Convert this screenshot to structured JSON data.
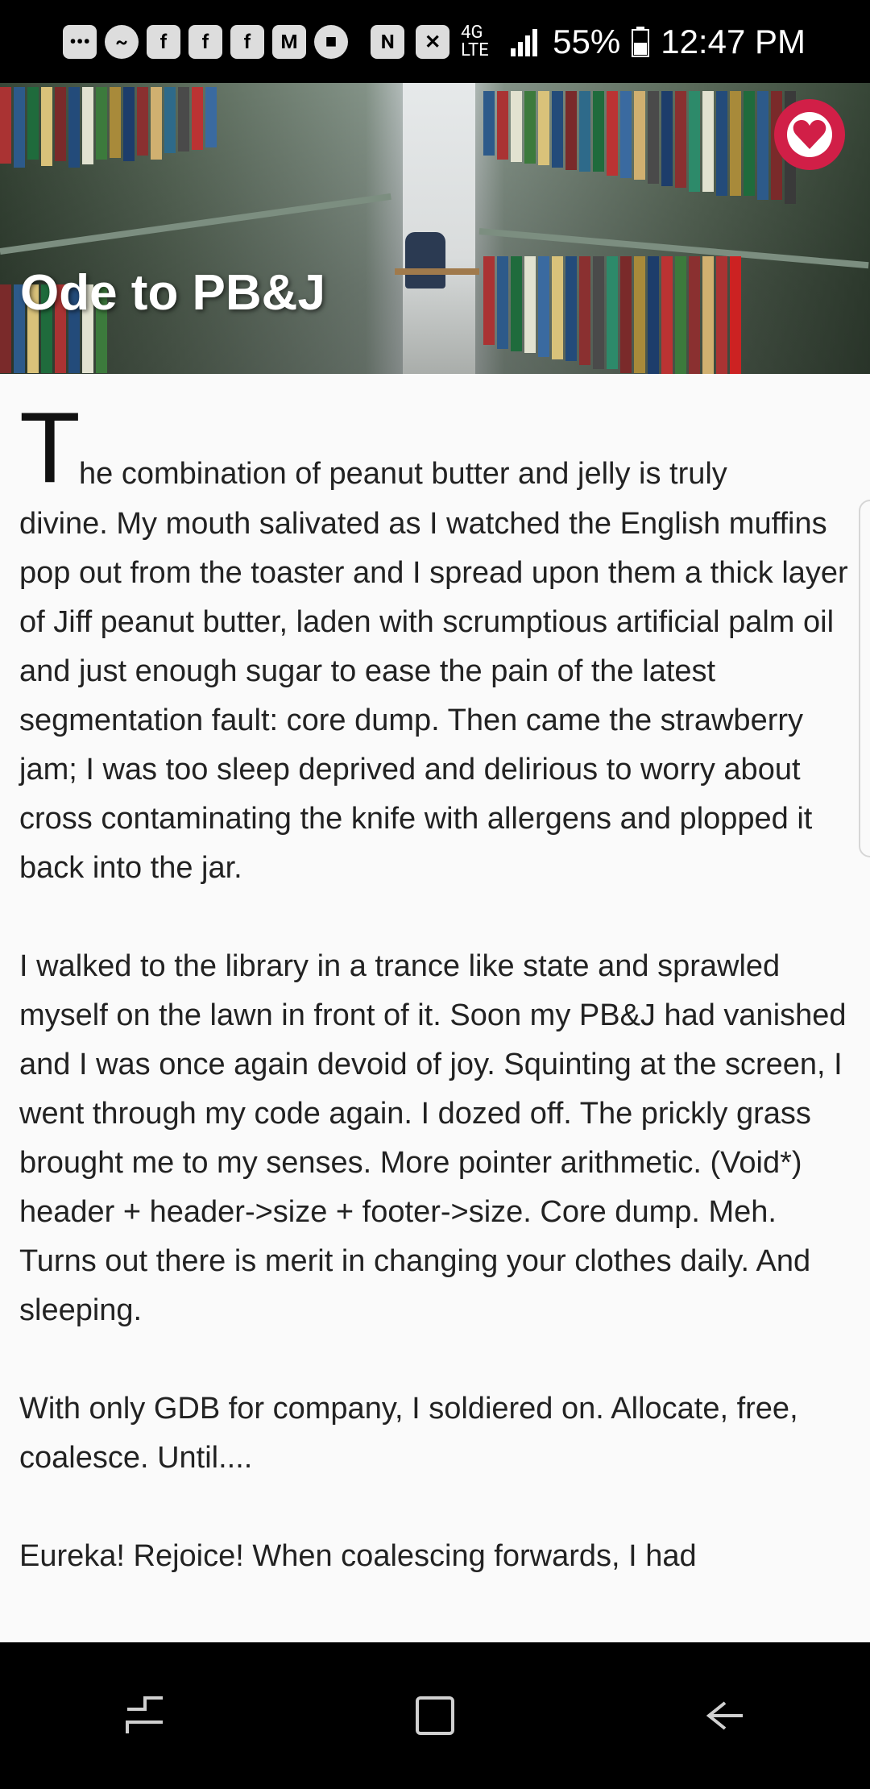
{
  "status_bar": {
    "notification_icons": [
      "more-icon",
      "messenger-icon",
      "facebook-icon",
      "facebook-icon",
      "facebook-icon",
      "gmail-icon",
      "stop-icon"
    ],
    "battery_percent": "55%",
    "network": "4G LTE",
    "time": "12:47 PM"
  },
  "header": {
    "title": "Ode to PB&J",
    "favorite_icon": "heart-icon",
    "accent_color": "#d11f47"
  },
  "article": {
    "drop_cap": "T",
    "first_line": "he combination of peanut butter and jelly is truly",
    "first_paragraph_rest": "divine. My mouth salivated as I watched the English muffins pop out from the toaster and I spread upon them a thick layer of Jiff peanut butter, laden with scrumptious artificial palm oil and just enough sugar to ease the pain of the latest segmentation fault: core dump. Then came the strawberry jam; I was too sleep deprived and delirious to worry about cross contaminating the knife with allergens and plopped it back into the jar.",
    "paragraphs": [
      "I walked to the library in a trance like state and sprawled myself on the lawn in front of it. Soon my PB&J had vanished and I was once again devoid of joy. Squinting at the screen, I went through my code again. I dozed off. The prickly grass brought me to my senses. More pointer arithmetic. (Void*) header + header->size + footer->size. Core dump. Meh. Turns out there is merit in changing your clothes daily. And sleeping.",
      "With only GDB for company, I soldiered on. Allocate, free, coalesce. Until....",
      "Eureka! Rejoice! When coalescing forwards, I had"
    ]
  },
  "nav_bar": {
    "recents_icon": "recents-icon",
    "home_icon": "home-icon",
    "back_icon": "back-icon"
  }
}
